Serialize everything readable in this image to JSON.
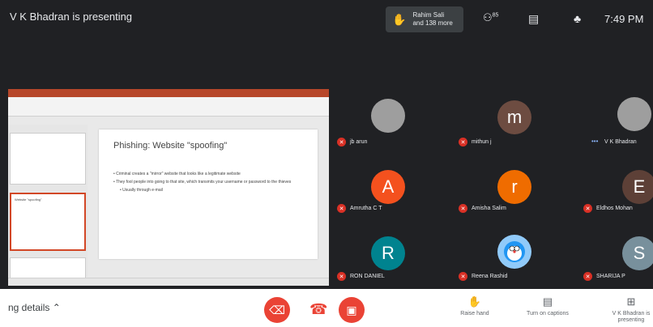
{
  "topbar": {
    "presenting_title": "V K Bhadran is presenting",
    "viewer_chip_line1": "Rahim Sali",
    "viewer_chip_line2": "and 138 more",
    "people_count": "85",
    "clock": "7:49 PM"
  },
  "slide": {
    "title": "Phishing: Website \"spoofing\"",
    "bullets": [
      "Criminal creates a \"mirror\" website that looks like a legitimate website",
      "They fool people into going to that site, which transmits your username or password to the thieves",
      "Usually through e-mail"
    ],
    "thumb_text": "Website \"spoofing\""
  },
  "participants": [
    {
      "name": "jb arun"
    },
    {
      "name": "mithun j",
      "initial": "m",
      "color": "#6d4c41"
    },
    {
      "name": "V K Bhadran"
    },
    {
      "name": "Amrutha C T",
      "initial": "A",
      "color": "#f4511e"
    },
    {
      "name": "Amisha Salim",
      "initial": "r",
      "color": "#ef6c00"
    },
    {
      "name": "Eldhos Mohan",
      "initial": "E",
      "color": "#5d4037"
    },
    {
      "name": "RON DANIEL",
      "initial": "R",
      "color": "#00838f"
    },
    {
      "name": "Reena Rashid"
    },
    {
      "name": "SHARIJA P",
      "initial": "S",
      "color": "#78909c"
    }
  ],
  "bottombar": {
    "meeting_details": "ng details",
    "raise_hand": "Raise hand",
    "captions": "Turn on captions",
    "presenter": "V K Bhadran is presenting"
  },
  "colors": {
    "stage_bg": "#202124",
    "danger": "#ea4335",
    "muted_badge": "#d93025"
  }
}
